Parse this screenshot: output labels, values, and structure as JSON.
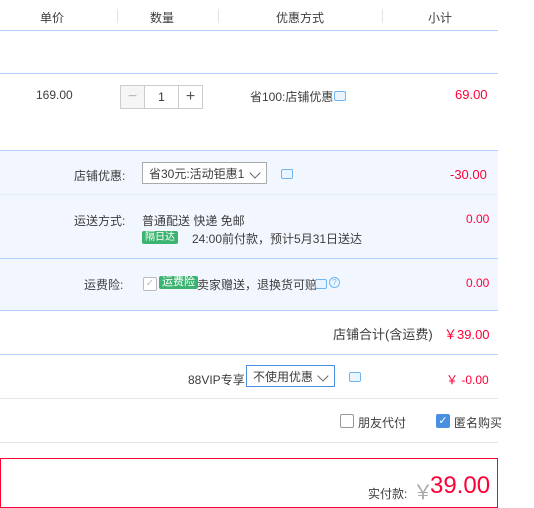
{
  "header": {
    "col_price": "单价",
    "col_qty": "数量",
    "col_promo": "优惠方式",
    "col_subtotal": "小计"
  },
  "item": {
    "unit_price": "169.00",
    "quantity": "1",
    "promo": "省100:店铺优惠",
    "subtotal": "69.00",
    "minus_icon": "minus-icon",
    "plus_icon": "plus-icon"
  },
  "shop_coupon": {
    "label": "店铺优惠:",
    "selected": "省30元:活动钜惠1",
    "amount": "-30.00"
  },
  "shipping": {
    "label": "运送方式:",
    "method": "普通配送 快递 免邮",
    "badge": "隔日达",
    "note": "24:00前付款，预计5月31日送达",
    "amount": "0.00"
  },
  "insurance": {
    "label": "运费险:",
    "badge": "运费险",
    "desc": "卖家赠送，退换货可赔",
    "amount": "0.00"
  },
  "shop_total": {
    "label": "店铺合计(含运费)",
    "amount": "￥39.00"
  },
  "vip": {
    "label": "88VIP专享",
    "selected": "不使用优惠",
    "amount": "￥ -0.00"
  },
  "options": {
    "friend_pay": "朋友代付",
    "anonymous": "匿名购买"
  },
  "payment": {
    "label": "实付款:",
    "currency": "￥",
    "amount": "39.00"
  },
  "colors": {
    "accent_red": "#ff0036",
    "blue_line": "#b2d1ff",
    "light_bg": "#f2f7ff",
    "green": "#3cb371"
  }
}
